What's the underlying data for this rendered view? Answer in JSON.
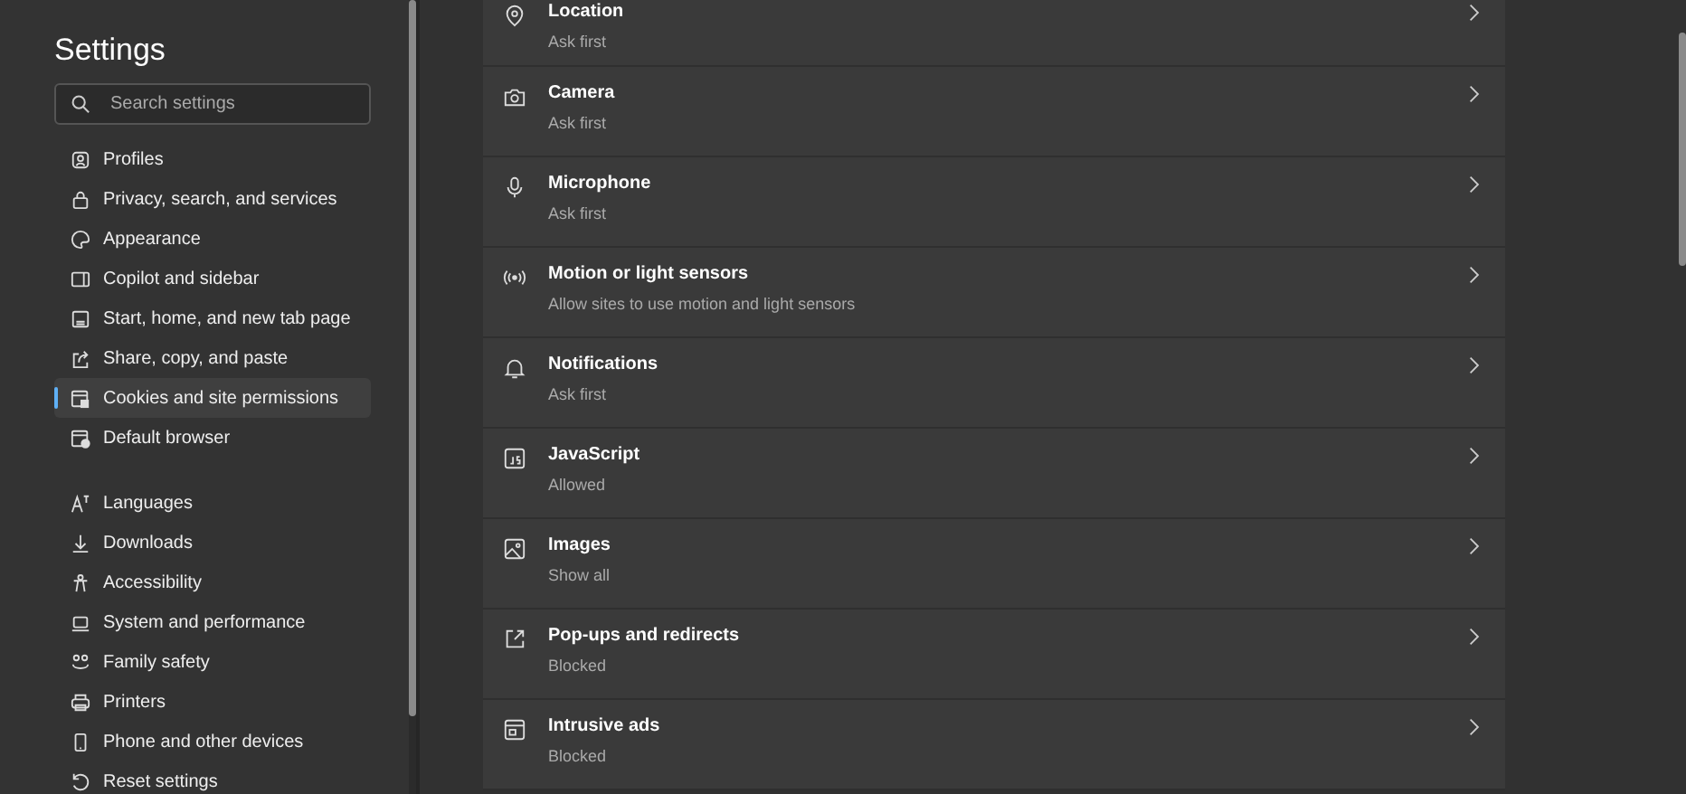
{
  "sidebar": {
    "title": "Settings",
    "search": {
      "placeholder": "Search settings"
    },
    "groups": [
      [
        {
          "label": "Profiles",
          "selected": false
        },
        {
          "label": "Privacy, search, and services",
          "selected": false
        },
        {
          "label": "Appearance",
          "selected": false
        },
        {
          "label": "Copilot and sidebar",
          "selected": false
        },
        {
          "label": "Start, home, and new tab page",
          "selected": false
        },
        {
          "label": "Share, copy, and paste",
          "selected": false
        },
        {
          "label": "Cookies and site permissions",
          "selected": true
        },
        {
          "label": "Default browser",
          "selected": false
        }
      ],
      [
        {
          "label": "Languages",
          "selected": false
        },
        {
          "label": "Downloads",
          "selected": false
        },
        {
          "label": "Accessibility",
          "selected": false
        },
        {
          "label": "System and performance",
          "selected": false
        },
        {
          "label": "Family safety",
          "selected": false
        },
        {
          "label": "Printers",
          "selected": false
        },
        {
          "label": "Phone and other devices",
          "selected": false
        },
        {
          "label": "Reset settings",
          "selected": false
        }
      ]
    ]
  },
  "permissions": [
    {
      "title": "Location",
      "subtitle": "Ask first"
    },
    {
      "title": "Camera",
      "subtitle": "Ask first"
    },
    {
      "title": "Microphone",
      "subtitle": "Ask first"
    },
    {
      "title": "Motion or light sensors",
      "subtitle": "Allow sites to use motion and light sensors"
    },
    {
      "title": "Notifications",
      "subtitle": "Ask first"
    },
    {
      "title": "JavaScript",
      "subtitle": "Allowed"
    },
    {
      "title": "Images",
      "subtitle": "Show all"
    },
    {
      "title": "Pop-ups and redirects",
      "subtitle": "Blocked"
    },
    {
      "title": "Intrusive ads",
      "subtitle": "Blocked"
    }
  ]
}
